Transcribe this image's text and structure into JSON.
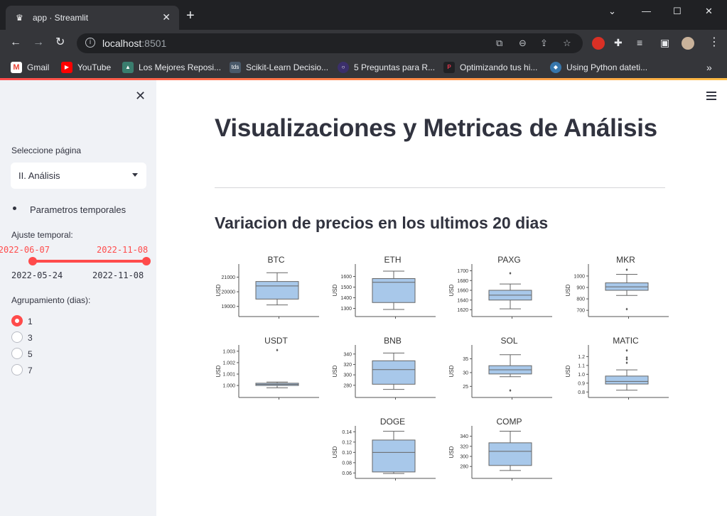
{
  "browser": {
    "tab_title": "app · Streamlit",
    "url_host": "localhost",
    "url_port": ":8501",
    "bookmarks": [
      {
        "label": "Gmail"
      },
      {
        "label": "YouTube"
      },
      {
        "label": "Los Mejores Reposi..."
      },
      {
        "label": "Scikit-Learn Decisio..."
      },
      {
        "label": "5 Preguntas para R..."
      },
      {
        "label": "Optimizando tus hi..."
      },
      {
        "label": "Using Python dateti..."
      }
    ]
  },
  "sidebar": {
    "page_select_label": "Seleccione página",
    "page_select_value": "II. Análisis",
    "bullet_text": "Parametros temporales",
    "slider_label": "Ajuste temporal:",
    "slider_value_start": "2022-06-07",
    "slider_value_end": "2022-11-08",
    "slider_min": "2022-05-24",
    "slider_max": "2022-11-08",
    "slider_range": [
      0.083,
      1.0
    ],
    "radio_label": "Agrupamiento (dias):",
    "radio_options": [
      "1",
      "3",
      "5",
      "7"
    ],
    "radio_selected": "1"
  },
  "main": {
    "title": "Visualizaciones y Metricas de Análisis",
    "subtitle": "Variacion de precios en los ultimos 20 dias"
  },
  "colors": {
    "accent": "#ff4b4b",
    "box_fill": "#a8c8ea"
  },
  "chart_data": {
    "type": "box",
    "ylabel": "USD",
    "panels": [
      {
        "name": "BTC",
        "ticks": [
          "19000",
          "20000",
          "21000"
        ],
        "ylim": [
          18500,
          21700
        ],
        "min": 19100,
        "q1": 19500,
        "median": 20400,
        "q3": 20700,
        "max": 21300,
        "outliers": []
      },
      {
        "name": "ETH",
        "ticks": [
          "1300",
          "1400",
          "1500",
          "1600"
        ],
        "ylim": [
          1250,
          1690
        ],
        "min": 1290,
        "q1": 1355,
        "median": 1545,
        "q3": 1580,
        "max": 1650,
        "outliers": []
      },
      {
        "name": "PAXG",
        "ticks": [
          "1620",
          "1640",
          "1660",
          "1680",
          "1700"
        ],
        "ylim": [
          1612,
          1708
        ],
        "min": 1622,
        "q1": 1640,
        "median": 1650,
        "q3": 1660,
        "max": 1673,
        "outliers": [
          1695
        ]
      },
      {
        "name": "MKR",
        "ticks": [
          "700",
          "800",
          "900",
          "1000"
        ],
        "ylim": [
          670,
          1080
        ],
        "min": 830,
        "q1": 875,
        "median": 905,
        "q3": 940,
        "max": 1015,
        "outliers": [
          1055,
          710
        ]
      },
      {
        "name": "USDT",
        "ticks": [
          "1.000",
          "1.001",
          "1.002",
          "1.003"
        ],
        "ylim": [
          0.9992,
          1.0033
        ],
        "min": 0.9998,
        "q1": 1.0,
        "median": 1.0001,
        "q3": 1.0002,
        "max": 1.0003,
        "outliers": [
          1.0031
        ]
      },
      {
        "name": "BNB",
        "ticks": [
          "280",
          "300",
          "320",
          "340"
        ],
        "ylim": [
          262,
          352
        ],
        "min": 272,
        "q1": 282,
        "median": 310,
        "q3": 327,
        "max": 342,
        "outliers": []
      },
      {
        "name": "SOL",
        "ticks": [
          "25",
          "30",
          "35"
        ],
        "ylim": [
          22,
          39
        ],
        "min": 28.5,
        "q1": 29.5,
        "median": 31,
        "q3": 32.5,
        "max": 36.5,
        "outliers": [
          23.5
        ]
      },
      {
        "name": "MATIC",
        "ticks": [
          "0.8",
          "0.9",
          "1.0",
          "1.1",
          "1.2"
        ],
        "ylim": [
          0.77,
          1.3
        ],
        "min": 0.82,
        "q1": 0.89,
        "median": 0.92,
        "q3": 0.98,
        "max": 1.05,
        "outliers": [
          1.13,
          1.17,
          1.19,
          1.27
        ]
      },
      {
        "name": "DOGE",
        "ticks": [
          "0.06",
          "0.08",
          "0.10",
          "0.12",
          "0.14"
        ],
        "ylim": [
          0.055,
          0.146
        ],
        "min": 0.059,
        "q1": 0.062,
        "median": 0.1,
        "q3": 0.124,
        "max": 0.141,
        "outliers": []
      },
      {
        "name": "COMP",
        "ticks": [
          "280",
          "300",
          "320",
          "340"
        ],
        "ylim": [
          262,
          355
        ],
        "min": 272,
        "q1": 282,
        "median": 310,
        "q3": 327,
        "max": 350,
        "outliers": []
      }
    ]
  }
}
